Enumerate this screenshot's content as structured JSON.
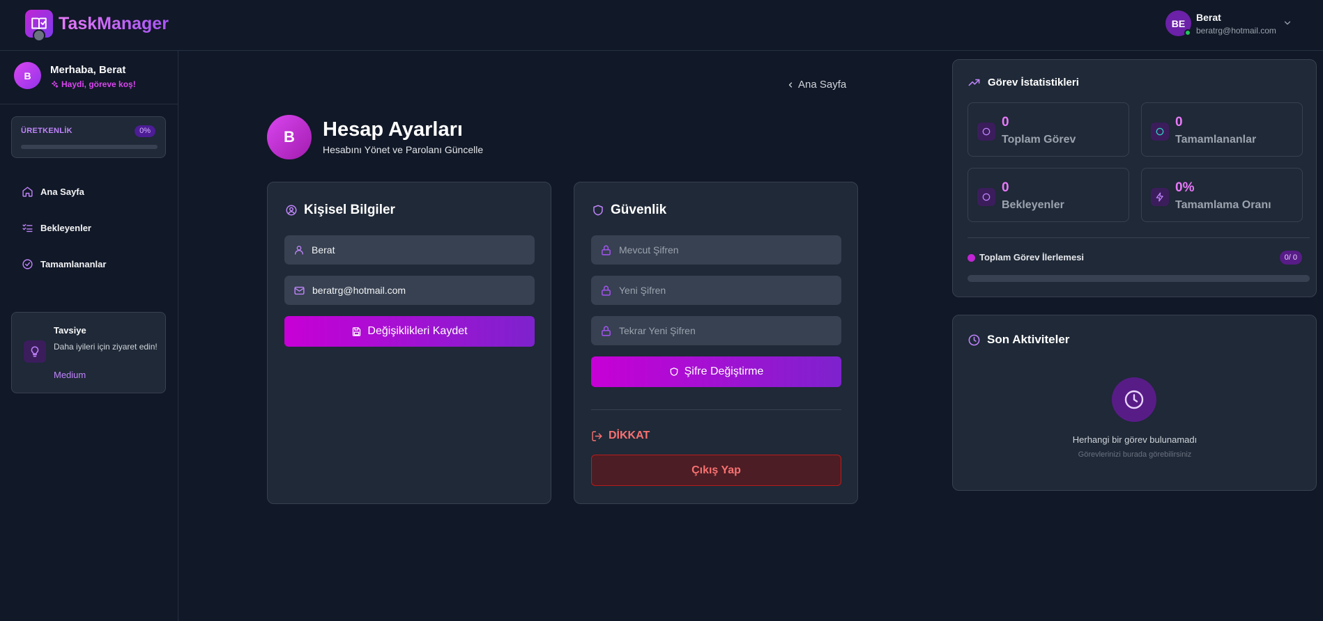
{
  "app": {
    "name": "TaskManager"
  },
  "header": {
    "user_initials": "BE",
    "user_name": "Berat",
    "user_email": "beratrg@hotmail.com"
  },
  "sidebar": {
    "avatar_initial": "B",
    "greeting": "Merhaba, Berat",
    "motto": "Haydi, göreve koş!",
    "productivity": {
      "label": "ÜRETKENLİK",
      "value": "0%",
      "progress": 0
    },
    "items": [
      {
        "label": "Ana Sayfa",
        "icon": "home-icon"
      },
      {
        "label": "Bekleyenler",
        "icon": "list-check-icon"
      },
      {
        "label": "Tamamlananlar",
        "icon": "check-circle-icon"
      }
    ],
    "tip": {
      "title": "Tavsiye",
      "text": "Daha iyileri için ziyaret edin!",
      "link": "Medium"
    }
  },
  "main": {
    "back_link": "Ana Sayfa",
    "avatar_initial": "B",
    "title": "Hesap Ayarları",
    "subtitle": "Hesabını Yönet ve Parolanı Güncelle",
    "personal": {
      "title": "Kişisel Bilgiler",
      "name_value": "Berat",
      "email_value": "beratrg@hotmail.com",
      "save_label": "Değişiklikleri Kaydet"
    },
    "security": {
      "title": "Güvenlik",
      "current_placeholder": "Mevcut Şifren",
      "new_placeholder": "Yeni Şifren",
      "repeat_placeholder": "Tekrar Yeni Şifren",
      "change_label": "Şifre Değiştirme",
      "warning_title": "DİKKAT",
      "logout_label": "Çıkış Yap"
    }
  },
  "stats": {
    "title": "Görev İstatistikleri",
    "boxes": [
      {
        "value": "0",
        "label": "Toplam Görev"
      },
      {
        "value": "0",
        "label": "Tamamlananlar"
      },
      {
        "value": "0",
        "label": "Bekleyenler"
      },
      {
        "value": "0%",
        "label": "Tamamlama Oranı"
      }
    ],
    "progress_label": "Toplam Görev İlerlemesi",
    "progress_badge": "0/ 0",
    "progress": 0
  },
  "activity": {
    "title": "Son Aktiviteler",
    "empty_text": "Herhangi bir görev bulunamadı",
    "empty_sub": "Görevlerinizi burada görebilirsiniz"
  },
  "colors": {
    "background": "#111827",
    "card": "#1f2937",
    "accent": "#c026d3",
    "accent_secondary": "#7e22ce",
    "danger": "#f87171",
    "online": "#22c55e"
  }
}
